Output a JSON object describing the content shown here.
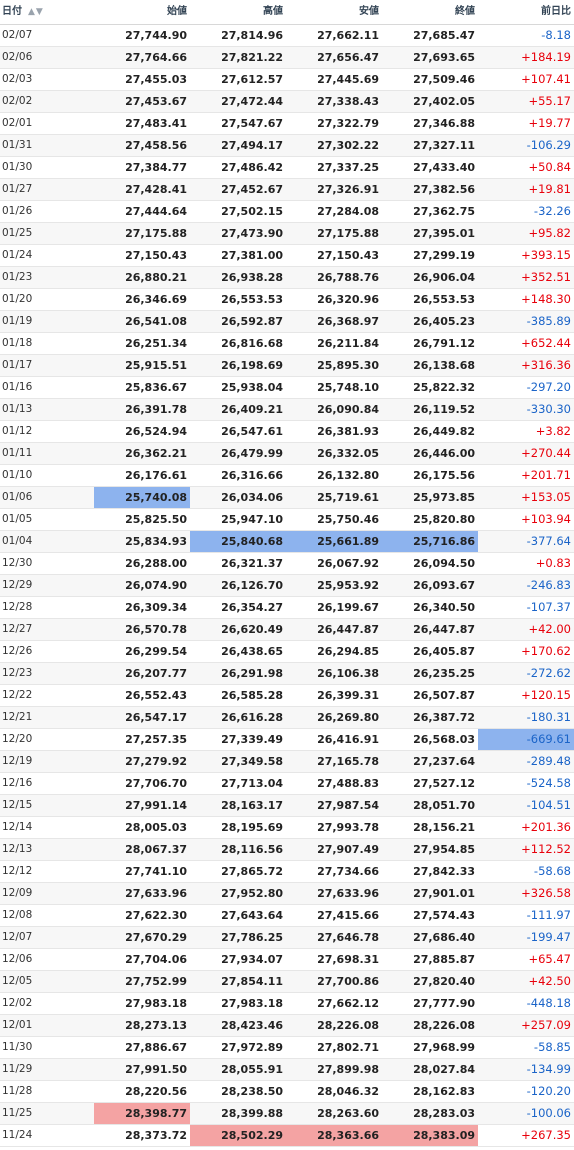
{
  "header": {
    "date": "日付",
    "sort_icons": "▲▼",
    "open": "始値",
    "high": "高値",
    "low": "安値",
    "close": "終値",
    "change": "前日比"
  },
  "colors": {
    "positive": "#e8000b",
    "negative": "#1b64c8",
    "min_highlight": "#8db3ee",
    "max_highlight": "#f4a3a3"
  },
  "rows": [
    {
      "date": "02/07",
      "open": "27,744.90",
      "high": "27,814.96",
      "low": "27,662.11",
      "close": "27,685.47",
      "change": "-8.18"
    },
    {
      "date": "02/06",
      "open": "27,764.66",
      "high": "27,821.22",
      "low": "27,656.47",
      "close": "27,693.65",
      "change": "+184.19"
    },
    {
      "date": "02/03",
      "open": "27,455.03",
      "high": "27,612.57",
      "low": "27,445.69",
      "close": "27,509.46",
      "change": "+107.41"
    },
    {
      "date": "02/02",
      "open": "27,453.67",
      "high": "27,472.44",
      "low": "27,338.43",
      "close": "27,402.05",
      "change": "+55.17"
    },
    {
      "date": "02/01",
      "open": "27,483.41",
      "high": "27,547.67",
      "low": "27,322.79",
      "close": "27,346.88",
      "change": "+19.77"
    },
    {
      "date": "01/31",
      "open": "27,458.56",
      "high": "27,494.17",
      "low": "27,302.22",
      "close": "27,327.11",
      "change": "-106.29"
    },
    {
      "date": "01/30",
      "open": "27,384.77",
      "high": "27,486.42",
      "low": "27,337.25",
      "close": "27,433.40",
      "change": "+50.84"
    },
    {
      "date": "01/27",
      "open": "27,428.41",
      "high": "27,452.67",
      "low": "27,326.91",
      "close": "27,382.56",
      "change": "+19.81"
    },
    {
      "date": "01/26",
      "open": "27,444.64",
      "high": "27,502.15",
      "low": "27,284.08",
      "close": "27,362.75",
      "change": "-32.26"
    },
    {
      "date": "01/25",
      "open": "27,175.88",
      "high": "27,473.90",
      "low": "27,175.88",
      "close": "27,395.01",
      "change": "+95.82"
    },
    {
      "date": "01/24",
      "open": "27,150.43",
      "high": "27,381.00",
      "low": "27,150.43",
      "close": "27,299.19",
      "change": "+393.15"
    },
    {
      "date": "01/23",
      "open": "26,880.21",
      "high": "26,938.28",
      "low": "26,788.76",
      "close": "26,906.04",
      "change": "+352.51"
    },
    {
      "date": "01/20",
      "open": "26,346.69",
      "high": "26,553.53",
      "low": "26,320.96",
      "close": "26,553.53",
      "change": "+148.30"
    },
    {
      "date": "01/19",
      "open": "26,541.08",
      "high": "26,592.87",
      "low": "26,368.97",
      "close": "26,405.23",
      "change": "-385.89"
    },
    {
      "date": "01/18",
      "open": "26,251.34",
      "high": "26,816.68",
      "low": "26,211.84",
      "close": "26,791.12",
      "change": "+652.44"
    },
    {
      "date": "01/17",
      "open": "25,915.51",
      "high": "26,198.69",
      "low": "25,895.30",
      "close": "26,138.68",
      "change": "+316.36"
    },
    {
      "date": "01/16",
      "open": "25,836.67",
      "high": "25,938.04",
      "low": "25,748.10",
      "close": "25,822.32",
      "change": "-297.20"
    },
    {
      "date": "01/13",
      "open": "26,391.78",
      "high": "26,409.21",
      "low": "26,090.84",
      "close": "26,119.52",
      "change": "-330.30"
    },
    {
      "date": "01/12",
      "open": "26,524.94",
      "high": "26,547.61",
      "low": "26,381.93",
      "close": "26,449.82",
      "change": "+3.82"
    },
    {
      "date": "01/11",
      "open": "26,362.21",
      "high": "26,479.99",
      "low": "26,332.05",
      "close": "26,446.00",
      "change": "+270.44"
    },
    {
      "date": "01/10",
      "open": "26,176.61",
      "high": "26,316.66",
      "low": "26,132.80",
      "close": "26,175.56",
      "change": "+201.71"
    },
    {
      "date": "01/06",
      "open": "25,740.08",
      "high": "26,034.06",
      "low": "25,719.61",
      "close": "25,973.85",
      "change": "+153.05"
    },
    {
      "date": "01/05",
      "open": "25,825.50",
      "high": "25,947.10",
      "low": "25,750.46",
      "close": "25,820.80",
      "change": "+103.94"
    },
    {
      "date": "01/04",
      "open": "25,834.93",
      "high": "25,840.68",
      "low": "25,661.89",
      "close": "25,716.86",
      "change": "-377.64"
    },
    {
      "date": "12/30",
      "open": "26,288.00",
      "high": "26,321.37",
      "low": "26,067.92",
      "close": "26,094.50",
      "change": "+0.83"
    },
    {
      "date": "12/29",
      "open": "26,074.90",
      "high": "26,126.70",
      "low": "25,953.92",
      "close": "26,093.67",
      "change": "-246.83"
    },
    {
      "date": "12/28",
      "open": "26,309.34",
      "high": "26,354.27",
      "low": "26,199.67",
      "close": "26,340.50",
      "change": "-107.37"
    },
    {
      "date": "12/27",
      "open": "26,570.78",
      "high": "26,620.49",
      "low": "26,447.87",
      "close": "26,447.87",
      "change": "+42.00"
    },
    {
      "date": "12/26",
      "open": "26,299.54",
      "high": "26,438.65",
      "low": "26,294.85",
      "close": "26,405.87",
      "change": "+170.62"
    },
    {
      "date": "12/23",
      "open": "26,207.77",
      "high": "26,291.98",
      "low": "26,106.38",
      "close": "26,235.25",
      "change": "-272.62"
    },
    {
      "date": "12/22",
      "open": "26,552.43",
      "high": "26,585.28",
      "low": "26,399.31",
      "close": "26,507.87",
      "change": "+120.15"
    },
    {
      "date": "12/21",
      "open": "26,547.17",
      "high": "26,616.28",
      "low": "26,269.80",
      "close": "26,387.72",
      "change": "-180.31"
    },
    {
      "date": "12/20",
      "open": "27,257.35",
      "high": "27,339.49",
      "low": "26,416.91",
      "close": "26,568.03",
      "change": "-669.61"
    },
    {
      "date": "12/19",
      "open": "27,279.92",
      "high": "27,349.58",
      "low": "27,165.78",
      "close": "27,237.64",
      "change": "-289.48"
    },
    {
      "date": "12/16",
      "open": "27,706.70",
      "high": "27,713.04",
      "low": "27,488.83",
      "close": "27,527.12",
      "change": "-524.58"
    },
    {
      "date": "12/15",
      "open": "27,991.14",
      "high": "28,163.17",
      "low": "27,987.54",
      "close": "28,051.70",
      "change": "-104.51"
    },
    {
      "date": "12/14",
      "open": "28,005.03",
      "high": "28,195.69",
      "low": "27,993.78",
      "close": "28,156.21",
      "change": "+201.36"
    },
    {
      "date": "12/13",
      "open": "28,067.37",
      "high": "28,116.56",
      "low": "27,907.49",
      "close": "27,954.85",
      "change": "+112.52"
    },
    {
      "date": "12/12",
      "open": "27,741.10",
      "high": "27,865.72",
      "low": "27,734.66",
      "close": "27,842.33",
      "change": "-58.68"
    },
    {
      "date": "12/09",
      "open": "27,633.96",
      "high": "27,952.80",
      "low": "27,633.96",
      "close": "27,901.01",
      "change": "+326.58"
    },
    {
      "date": "12/08",
      "open": "27,622.30",
      "high": "27,643.64",
      "low": "27,415.66",
      "close": "27,574.43",
      "change": "-111.97"
    },
    {
      "date": "12/07",
      "open": "27,670.29",
      "high": "27,786.25",
      "low": "27,646.78",
      "close": "27,686.40",
      "change": "-199.47"
    },
    {
      "date": "12/06",
      "open": "27,704.06",
      "high": "27,934.07",
      "low": "27,698.31",
      "close": "27,885.87",
      "change": "+65.47"
    },
    {
      "date": "12/05",
      "open": "27,752.99",
      "high": "27,854.11",
      "low": "27,700.86",
      "close": "27,820.40",
      "change": "+42.50"
    },
    {
      "date": "12/02",
      "open": "27,983.18",
      "high": "27,983.18",
      "low": "27,662.12",
      "close": "27,777.90",
      "change": "-448.18"
    },
    {
      "date": "12/01",
      "open": "28,273.13",
      "high": "28,423.46",
      "low": "28,226.08",
      "close": "28,226.08",
      "change": "+257.09"
    },
    {
      "date": "11/30",
      "open": "27,886.67",
      "high": "27,972.89",
      "low": "27,802.71",
      "close": "27,968.99",
      "change": "-58.85"
    },
    {
      "date": "11/29",
      "open": "27,991.50",
      "high": "28,055.91",
      "low": "27,899.98",
      "close": "28,027.84",
      "change": "-134.99"
    },
    {
      "date": "11/28",
      "open": "28,220.56",
      "high": "28,238.50",
      "low": "28,046.32",
      "close": "28,162.83",
      "change": "-120.20"
    },
    {
      "date": "11/25",
      "open": "28,398.77",
      "high": "28,399.88",
      "low": "28,263.60",
      "close": "28,283.03",
      "change": "-100.06"
    },
    {
      "date": "11/24",
      "open": "28,373.72",
      "high": "28,502.29",
      "low": "28,363.66",
      "close": "28,383.09",
      "change": "+267.35"
    }
  ],
  "highlights": [
    {
      "row": 21,
      "col": "open",
      "kind": "min"
    },
    {
      "row": 23,
      "col": "high",
      "kind": "min"
    },
    {
      "row": 23,
      "col": "low",
      "kind": "min"
    },
    {
      "row": 23,
      "col": "close",
      "kind": "min"
    },
    {
      "row": 32,
      "col": "change",
      "kind": "min"
    },
    {
      "row": 49,
      "col": "open",
      "kind": "max"
    },
    {
      "row": 50,
      "col": "high",
      "kind": "max"
    },
    {
      "row": 50,
      "col": "low",
      "kind": "max"
    },
    {
      "row": 50,
      "col": "close",
      "kind": "max"
    }
  ]
}
